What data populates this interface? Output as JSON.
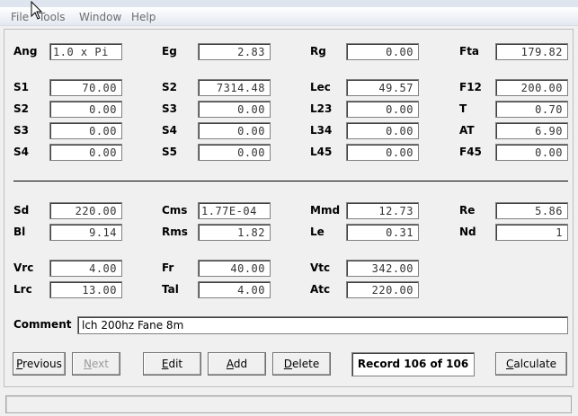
{
  "menu": [
    "File",
    "Tools",
    "Window",
    "Help"
  ],
  "rows_top": [
    [
      {
        "label": "Ang",
        "value": "1.0 x Pi",
        "align": "left"
      },
      {
        "label": "Eg",
        "value": "2.83"
      },
      {
        "label": "Rg",
        "value": "0.00"
      },
      {
        "label": "Fta",
        "value": "179.82"
      }
    ],
    [
      {
        "label": "S1",
        "value": "70.00"
      },
      {
        "label": "S2",
        "value": "7314.48"
      },
      {
        "label": "Lec",
        "value": "49.57"
      },
      {
        "label": "F12",
        "value": "200.00"
      }
    ],
    [
      {
        "label": "S2",
        "value": "0.00"
      },
      {
        "label": "S3",
        "value": "0.00"
      },
      {
        "label": "L23",
        "value": "0.00"
      },
      {
        "label": "T",
        "value": "0.70"
      }
    ],
    [
      {
        "label": "S3",
        "value": "0.00"
      },
      {
        "label": "S4",
        "value": "0.00"
      },
      {
        "label": "L34",
        "value": "0.00"
      },
      {
        "label": "AT",
        "value": "6.90"
      }
    ],
    [
      {
        "label": "S4",
        "value": "0.00"
      },
      {
        "label": "S5",
        "value": "0.00"
      },
      {
        "label": "L45",
        "value": "0.00"
      },
      {
        "label": "F45",
        "value": "0.00"
      }
    ]
  ],
  "rows_bottom": [
    [
      {
        "label": "Sd",
        "value": "220.00"
      },
      {
        "label": "Cms",
        "value": "1.77E-04",
        "align": "left"
      },
      {
        "label": "Mmd",
        "value": "12.73"
      },
      {
        "label": "Re",
        "value": "5.86"
      }
    ],
    [
      {
        "label": "Bl",
        "value": "9.14"
      },
      {
        "label": "Rms",
        "value": "1.82"
      },
      {
        "label": "Le",
        "value": "0.31"
      },
      {
        "label": "Nd",
        "value": "1"
      }
    ],
    [
      {
        "label": "Vrc",
        "value": "4.00"
      },
      {
        "label": "Fr",
        "value": "40.00"
      },
      {
        "label": "Vtc",
        "value": "342.00"
      }
    ],
    [
      {
        "label": "Lrc",
        "value": "13.00"
      },
      {
        "label": "Tal",
        "value": "4.00"
      },
      {
        "label": "Atc",
        "value": "220.00"
      }
    ]
  ],
  "comment": {
    "label": "Comment",
    "value": "lch 200hz Fane 8m"
  },
  "buttons": {
    "previous": {
      "u": "P",
      "rest": "revious"
    },
    "next": {
      "u": "N",
      "rest": "ext"
    },
    "edit": {
      "u": "E",
      "rest": "dit"
    },
    "add": {
      "u": "A",
      "rest": "dd"
    },
    "delete": {
      "u": "D",
      "rest": "elete"
    },
    "calculate": {
      "u": "C",
      "rest": "alculate"
    }
  },
  "record_status": "Record 106 of 106",
  "colors": {
    "background": "#f0f0f0",
    "field": "#ffffff",
    "disabled_text": "#9a9a9a"
  }
}
